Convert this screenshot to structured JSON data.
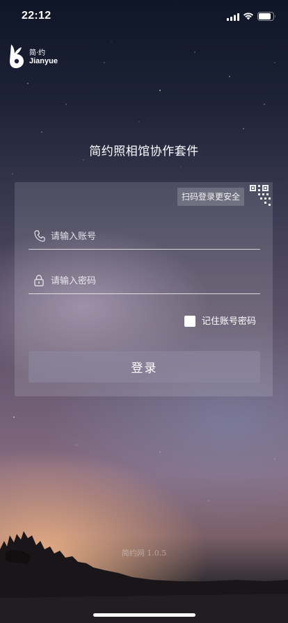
{
  "status_bar": {
    "time": "22:12",
    "signal_icon": "cellular-signal-icon",
    "wifi_icon": "wifi-icon",
    "battery_icon": "battery-icon"
  },
  "brand": {
    "name_cn": "简·约",
    "name_en": "Jianyue",
    "icon": "rabbit-logo-icon"
  },
  "app_title": "简约照相馆协作套件",
  "login_card": {
    "qr_tip": "扫码登录更安全",
    "qr_icon": "qr-code-icon",
    "phone": {
      "placeholder": "请输入账号",
      "value": "",
      "icon": "phone-icon"
    },
    "password": {
      "placeholder": "请输入密码",
      "value": "",
      "icon": "lock-icon"
    },
    "remember": {
      "label": "记住账号密码",
      "checked": false
    },
    "login_label": "登录"
  },
  "footer": {
    "version": "简约网 1.0.5"
  },
  "colors": {
    "button": "#8c87a0",
    "text": "#ffffff"
  }
}
